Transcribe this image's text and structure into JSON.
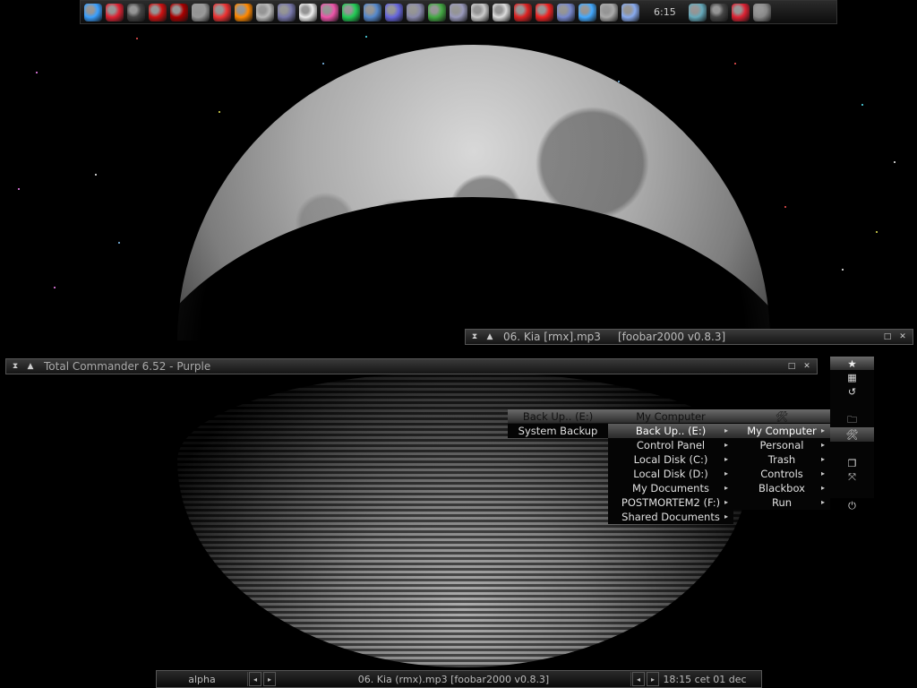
{
  "toolbar": {
    "clock": "6:15",
    "icons": [
      {
        "name": "messenger-icon",
        "color": "#3aa0ff"
      },
      {
        "name": "calendar-icon",
        "color": "#d23"
      },
      {
        "name": "blackbox-icon",
        "color": "#444"
      },
      {
        "name": "lifebuoy-icon",
        "color": "#c11"
      },
      {
        "name": "record-icon",
        "color": "#a00"
      },
      {
        "name": "cd-drive-icon",
        "color": "#999"
      },
      {
        "name": "ruby-icon",
        "color": "#e33"
      },
      {
        "name": "fruity-loops-icon",
        "color": "#f80"
      },
      {
        "name": "disc-icon",
        "color": "#bbb"
      },
      {
        "name": "notepad-icon",
        "color": "#77a"
      },
      {
        "name": "flower-icon",
        "color": "#eee"
      },
      {
        "name": "palette-icon",
        "color": "#e5a"
      },
      {
        "name": "play-icon",
        "color": "#2c5"
      },
      {
        "name": "monitor-icon",
        "color": "#58c"
      },
      {
        "name": "paint-icon",
        "color": "#66d"
      },
      {
        "name": "tools-icon",
        "color": "#88a"
      },
      {
        "name": "gear-icon",
        "color": "#4a4"
      },
      {
        "name": "settings-icon",
        "color": "#99b"
      },
      {
        "name": "cog-icon",
        "color": "#ccc"
      },
      {
        "name": "target-icon",
        "color": "#ddd"
      },
      {
        "name": "hand-icon",
        "color": "#d22"
      },
      {
        "name": "k-icon",
        "color": "#e22"
      },
      {
        "name": "globe-icon",
        "color": "#78c"
      },
      {
        "name": "internet-icon",
        "color": "#4af"
      },
      {
        "name": "network-icon",
        "color": "#aaa"
      },
      {
        "name": "wrench-icon",
        "color": "#8ae"
      }
    ],
    "right_icons": [
      {
        "name": "drive-icon",
        "color": "#6ab"
      },
      {
        "name": "blackbox-icon",
        "color": "#444"
      },
      {
        "name": "calendar-icon",
        "color": "#d23"
      },
      {
        "name": "refresh-icon",
        "color": "#888"
      }
    ]
  },
  "foobar": {
    "title": "06. Kia [rmx].mp3     [foobar2000 v0.8.3]"
  },
  "total_commander": {
    "title": "Total Commander 6.52 - Purple"
  },
  "menu1": {
    "header": "Back Up.. (E:)",
    "items": [
      "System Backup"
    ]
  },
  "menu2": {
    "header": "My Computer",
    "items": [
      "Back Up.. (E:)",
      "Control Panel",
      "Local Disk (C:)",
      "Local Disk (D:)",
      "My Documents",
      "POSTMORTEM2 (F:)",
      "Shared Documents"
    ]
  },
  "menu3": {
    "items": [
      "My Computer",
      "Personal",
      "Trash",
      "Controls",
      "Blackbox",
      "Run"
    ]
  },
  "slit": {
    "icons": [
      "star-icon",
      "apps-icon",
      "undo-icon",
      "",
      "folder-icon",
      "tools-icon",
      "",
      "window-icon",
      "resize-icon",
      "",
      "power-icon"
    ]
  },
  "bottombar": {
    "workspace": "alpha",
    "task": "06. Kia (rmx).mp3     [foobar2000 v0.8.3]",
    "clock": "18:15 cet 01 dec"
  }
}
